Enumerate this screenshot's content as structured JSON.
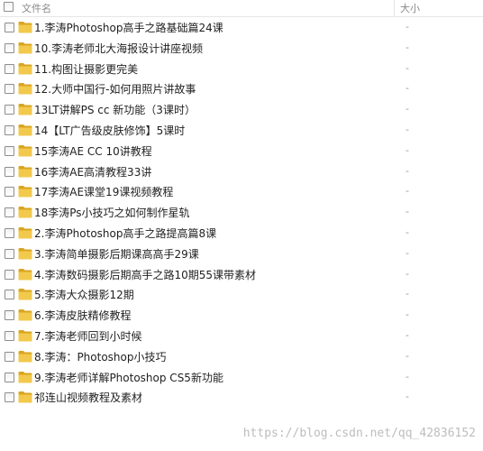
{
  "header": {
    "name_label": "文件名",
    "size_label": "大小"
  },
  "icons": {
    "folder": "folder-icon",
    "checkbox": "checkbox-icon"
  },
  "colors": {
    "folder": "#f2c94c",
    "folder_dark": "#d9a521"
  },
  "rows": [
    {
      "name": "1.李涛Photoshop高手之路基础篇24课",
      "size": "-"
    },
    {
      "name": "10.李涛老师北大海报设计讲座视频",
      "size": "-"
    },
    {
      "name": "11.构图让摄影更完美",
      "size": "-"
    },
    {
      "name": "12.大师中国行-如何用照片讲故事",
      "size": "-"
    },
    {
      "name": "13LT讲解PS cc 新功能（3课时）",
      "size": "-"
    },
    {
      "name": "14【LT广告级皮肤修饰】5课时",
      "size": "-"
    },
    {
      "name": "15李涛AE CC 10讲教程",
      "size": "-"
    },
    {
      "name": "16李涛AE高清教程33讲",
      "size": "-"
    },
    {
      "name": "17李涛AE课堂19课视频教程",
      "size": "-"
    },
    {
      "name": "18李涛Ps小技巧之如何制作星轨",
      "size": "-"
    },
    {
      "name": "2.李涛Photoshop高手之路提高篇8课",
      "size": "-"
    },
    {
      "name": "3.李涛简单摄影后期课高高手29课",
      "size": "-"
    },
    {
      "name": "4.李涛数码摄影后期高手之路10期55课带素材",
      "size": "-"
    },
    {
      "name": "5.李涛大众摄影12期",
      "size": "-"
    },
    {
      "name": "6.李涛皮肤精修教程",
      "size": "-"
    },
    {
      "name": "7.李涛老师回到小时候",
      "size": "-"
    },
    {
      "name": "8.李涛：Photoshop小技巧",
      "size": "-"
    },
    {
      "name": "9.李涛老师详解Photoshop CS5新功能",
      "size": "-"
    },
    {
      "name": "祁连山视频教程及素材",
      "size": "-"
    }
  ],
  "watermark": "https://blog.csdn.net/qq_42836152"
}
